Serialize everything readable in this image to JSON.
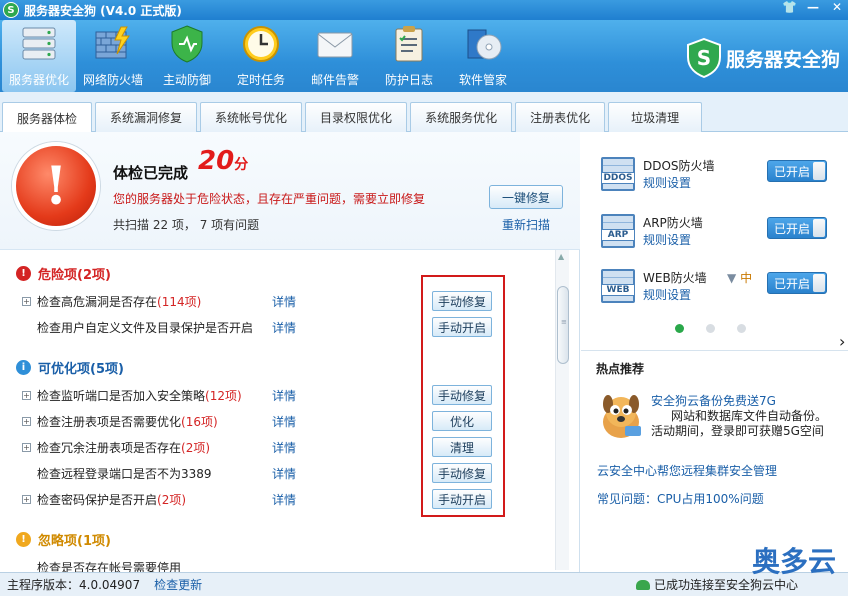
{
  "window": {
    "title": "服务器安全狗 (V4.0 正式版)",
    "controls": [
      "shirt-icon",
      "minimize-icon",
      "close-icon"
    ],
    "control_glyphs": [
      "👕",
      "—",
      "✕"
    ]
  },
  "toolbar": {
    "items": [
      {
        "label": "服务器优化",
        "icon": "server-icon",
        "active": true
      },
      {
        "label": "网络防火墙",
        "icon": "firewall-icon"
      },
      {
        "label": "主动防御",
        "icon": "shield-icon"
      },
      {
        "label": "定时任务",
        "icon": "clock-icon"
      },
      {
        "label": "邮件告警",
        "icon": "mail-icon"
      },
      {
        "label": "防护日志",
        "icon": "log-icon"
      },
      {
        "label": "软件管家",
        "icon": "software-icon"
      }
    ],
    "brand": "服务器安全狗"
  },
  "tabs": [
    "服务器体检",
    "系统漏洞修复",
    "系统帐号优化",
    "目录权限优化",
    "系统服务优化",
    "注册表优化",
    "垃圾清理"
  ],
  "summary": {
    "title": "体检已完成",
    "score": "20",
    "score_unit": "分",
    "warning": "您的服务器处于危险状态，且存在严重问题，需要立即修复",
    "count": "共扫描 22 项， 7 项有问题",
    "fix_button": "一键修复",
    "rescan": "重新扫描"
  },
  "sections": {
    "danger": {
      "title": "危险项(2项)",
      "color": "#d42424"
    },
    "optimize": {
      "title": "可优化项(5项)",
      "color": "#2f8fd8"
    },
    "ignore": {
      "title": "忽略项(1项)",
      "color": "#f0a81e"
    }
  },
  "rows": [
    {
      "text": "检查高危漏洞是否存在",
      "count": "(114项)",
      "detail": "详情",
      "action": "手动修复",
      "plus": true
    },
    {
      "text": "检查用户自定义文件及目录保护是否开启",
      "count": "",
      "detail": "详情",
      "action": "手动开启",
      "plus": false
    },
    {
      "text": "检查监听端口是否加入安全策略",
      "count": "(12项)",
      "detail": "详情",
      "action": "手动修复",
      "plus": true
    },
    {
      "text": "检查注册表项是否需要优化",
      "count": "(16项)",
      "detail": "详情",
      "action": "优化",
      "plus": true
    },
    {
      "text": "检查冗余注册表项是否存在",
      "count": "(2项)",
      "detail": "详情",
      "action": "清理",
      "plus": true
    },
    {
      "text": "检查远程登录端口是否不为3389",
      "count": "",
      "detail": "详情",
      "action": "手动修复",
      "plus": false
    },
    {
      "text": "检查密码保护是否开启",
      "count": "(2项)",
      "detail": "详情",
      "action": "手动开启",
      "plus": true
    },
    {
      "text": "检查是否存在帐号需要停用",
      "count": "",
      "detail": "",
      "action": "",
      "plus": false
    }
  ],
  "firewalls": [
    {
      "badge": "DDOS",
      "name": "DDOS防火墙",
      "setting": "规则设置",
      "state": "已开启",
      "level": ""
    },
    {
      "badge": "ARP",
      "name": "ARP防火墙",
      "setting": "规则设置",
      "state": "已开启",
      "level": ""
    },
    {
      "badge": "WEB",
      "name": "WEB防火墙",
      "setting": "规则设置",
      "state": "已开启",
      "level": "中"
    }
  ],
  "hot": {
    "title": "热点推荐",
    "promo_title": "安全狗云备份免费送7G",
    "promo_line1": "网站和数据库文件自动备份。",
    "promo_line2": "活动期间，登录即可获赠5G空间",
    "link1": "云安全中心帮您远程集群安全管理",
    "link2": "常见问题：CPU占用100%问题"
  },
  "status": {
    "version": "主程序版本：4.0.04907",
    "update": "检查更新",
    "connection": "已成功连接至安全狗云中心"
  },
  "watermark": "奥多云",
  "colors": {
    "accent": "#2e8fd9",
    "danger": "#d42424",
    "link": "#1a5fa8"
  }
}
